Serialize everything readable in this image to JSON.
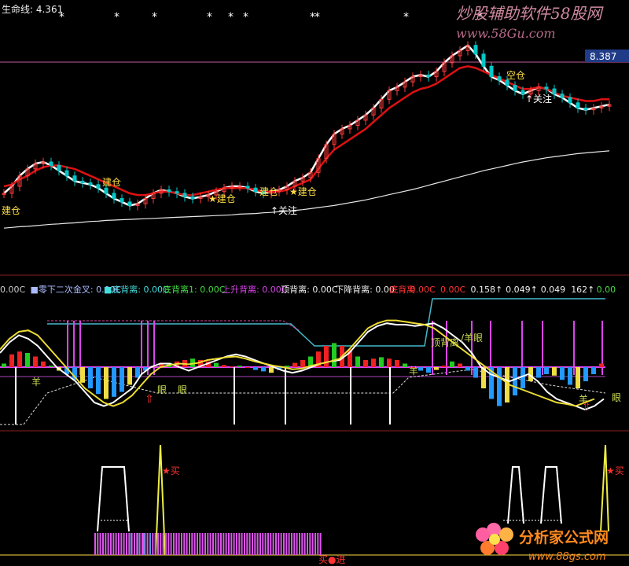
{
  "colors": {
    "background": "#000000",
    "ma_white": "#ffffff",
    "ma_red": "#dd1111",
    "candle_up": "#ff3b3b",
    "candle_down": "#00c8c8",
    "osc_red": "#ee2222",
    "osc_green": "#22cc22",
    "osc_blue": "#2299ff",
    "osc_yellow": "#eedd44",
    "magenta": "#dd44ee",
    "cyan": "#44bbcc",
    "divider": "#8a2020",
    "price_box": "#203c88"
  },
  "top_panel": {
    "indicator_label": "生命线: 4.361",
    "price_tag": "8.387",
    "signals": [
      {
        "text": "建仓",
        "style": "plain"
      },
      {
        "text": "建仓",
        "style": "plain"
      },
      {
        "text": "★建仓",
        "style": "star"
      },
      {
        "text": "建仓",
        "style": "plain"
      },
      {
        "text": "★建仓",
        "style": "star"
      },
      {
        "text": "↑关注",
        "style": "arrow"
      },
      {
        "text": "空仓",
        "style": "plain"
      },
      {
        "text": "↑关注",
        "style": "arrow"
      }
    ]
  },
  "middle_panel": {
    "legend": [
      {
        "text": "0.00C",
        "color": "#cccccc"
      },
      {
        "text": "■零下二次金叉: 0.00C",
        "color": "#aabbff"
      },
      {
        "text": "■底背离: 0.00C",
        "color": "#44dddd"
      },
      {
        "text": "底背离1: 0.00C",
        "color": "#44dd44"
      },
      {
        "text": "上升背离: 0.00C",
        "color": "#dd44ee"
      },
      {
        "text": "顶背离: 0.00C",
        "color": "#eeeeee"
      },
      {
        "text": "下降背离: 0.00",
        "color": "#eeeeee"
      },
      {
        "text": "底背离",
        "color": "#ff3333"
      },
      {
        "text": "0.00C",
        "color": "#ff3333"
      },
      {
        "text": "0.00C",
        "color": "#ff3333"
      },
      {
        "text": "0.158↑",
        "color": "#eeeeee"
      },
      {
        "text": "0.049↑",
        "color": "#eeeeee"
      },
      {
        "text": "0.049",
        "color": "#eeeeee"
      },
      {
        "text": "162↑",
        "color": "#eeeeee"
      },
      {
        "text": "0.00",
        "color": "#44dd44"
      }
    ],
    "annotations": [
      "羊",
      "眼",
      "眼",
      "顶背离",
      "/羊眼",
      "羊",
      "羊",
      "眼"
    ]
  },
  "bottom_panel": {
    "buy_labels": [
      "★买",
      "★买"
    ],
    "bottom_label": "买●进"
  },
  "watermarks": {
    "top": "炒股辅助软件58股网",
    "top_url": "www.58Gu.com",
    "bottom": "分析家公式网",
    "bottom_url": "www.88gs.com"
  },
  "chart_data": [
    {
      "type": "line",
      "panel": "price",
      "x": [
        0,
        10,
        20,
        30,
        40,
        50,
        60,
        70,
        80,
        90,
        100,
        110,
        120,
        130,
        140,
        150,
        160,
        170,
        180,
        190,
        200,
        210,
        220,
        230,
        240,
        250,
        260,
        270,
        280,
        290,
        300,
        310,
        320,
        330,
        340,
        350,
        360,
        370,
        380,
        390,
        400,
        410,
        420,
        430,
        440,
        450,
        460,
        470,
        480,
        490,
        500,
        510,
        520,
        530,
        540,
        550,
        560,
        570,
        580,
        590,
        600,
        610,
        620,
        630,
        640,
        650,
        660,
        670,
        680,
        690,
        700,
        710,
        720,
        730,
        740,
        750,
        760,
        770
      ],
      "series": [
        {
          "values": [
            5.1,
            5.3,
            5.6,
            5.8,
            5.95,
            6.0,
            5.9,
            5.75,
            5.6,
            5.45,
            5.4,
            5.35,
            5.25,
            5.1,
            4.95,
            4.85,
            4.75,
            4.8,
            4.95,
            5.1,
            5.2,
            5.15,
            5.1,
            5.0,
            4.95,
            5.0,
            5.05,
            5.15,
            5.25,
            5.3,
            5.3,
            5.25,
            5.15,
            5.1,
            5.15,
            5.2,
            5.3,
            5.45,
            5.55,
            5.7,
            6.1,
            6.5,
            6.8,
            6.95,
            7.05,
            7.2,
            7.35,
            7.55,
            7.8,
            8.05,
            8.15,
            8.3,
            8.45,
            8.5,
            8.45,
            8.6,
            8.85,
            9.05,
            9.2,
            9.35,
            9.1,
            8.75,
            8.45,
            8.35,
            8.2,
            8.05,
            7.95,
            8.05,
            8.15,
            8.1,
            7.95,
            7.85,
            7.7,
            7.55,
            7.5,
            7.55,
            7.6,
            7.65
          ]
        },
        {
          "values": [
            5.3,
            5.35,
            5.5,
            5.6,
            5.75,
            5.85,
            5.9,
            5.9,
            5.85,
            5.8,
            5.7,
            5.6,
            5.5,
            5.4,
            5.3,
            5.2,
            5.1,
            5.05,
            5.05,
            5.1,
            5.15,
            5.15,
            5.1,
            5.05,
            5.05,
            5.1,
            5.15,
            5.2,
            5.25,
            5.25,
            5.25,
            5.25,
            5.2,
            5.15,
            5.15,
            5.15,
            5.2,
            5.3,
            5.4,
            5.5,
            5.8,
            6.1,
            6.35,
            6.5,
            6.65,
            6.8,
            6.95,
            7.15,
            7.35,
            7.55,
            7.7,
            7.85,
            8.0,
            8.1,
            8.15,
            8.25,
            8.4,
            8.55,
            8.7,
            8.75,
            8.7,
            8.6,
            8.5,
            8.4,
            8.3,
            8.2,
            8.1,
            8.1,
            8.15,
            8.1,
            8.0,
            7.9,
            7.85,
            7.8,
            7.75,
            7.75,
            7.8,
            7.8
          ]
        },
        {
          "values": [
            4.1,
            4.12,
            4.14,
            4.15,
            4.17,
            4.19,
            4.21,
            4.22,
            4.24,
            4.25,
            4.27,
            4.29,
            4.3,
            4.32,
            4.33,
            4.34,
            4.35,
            4.36,
            4.37,
            4.38,
            4.39,
            4.4,
            4.41,
            4.42,
            4.43,
            4.44,
            4.45,
            4.46,
            4.47,
            4.48,
            4.5,
            4.51,
            4.52,
            4.54,
            4.55,
            4.57,
            4.59,
            4.61,
            4.63,
            4.66,
            4.69,
            4.72,
            4.75,
            4.79,
            4.83,
            4.87,
            4.91,
            4.96,
            5.01,
            5.06,
            5.11,
            5.16,
            5.21,
            5.27,
            5.33,
            5.39,
            5.45,
            5.51,
            5.57,
            5.63,
            5.69,
            5.75,
            5.8,
            5.85,
            5.9,
            5.95,
            6.0,
            6.04,
            6.08,
            6.12,
            6.15,
            6.18,
            6.21,
            6.24,
            6.26,
            6.28,
            6.3,
            6.32
          ]
        }
      ],
      "ylim": [
        3.2,
        9.75
      ]
    },
    {
      "type": "bar",
      "panel": "oscillator",
      "x": [
        0,
        10,
        20,
        30,
        40,
        50,
        60,
        70,
        80,
        90,
        100,
        110,
        120,
        130,
        140,
        150,
        160,
        170,
        180,
        190,
        200,
        210,
        220,
        230,
        240,
        250,
        260,
        270,
        280,
        290,
        300,
        310,
        320,
        330,
        340,
        350,
        360,
        370,
        380,
        390,
        400,
        410,
        420,
        430,
        440,
        450,
        460,
        470,
        480,
        490,
        500,
        510,
        520,
        530,
        540,
        550,
        560,
        570,
        580,
        590,
        600,
        610,
        620,
        630,
        640,
        650,
        660,
        670,
        680,
        690,
        700,
        710,
        720,
        730,
        740,
        750,
        760
      ],
      "values": [
        0.05,
        0.18,
        0.22,
        0.2,
        0.15,
        0.08,
        0.02,
        -0.05,
        -0.1,
        -0.18,
        -0.22,
        -0.3,
        -0.38,
        -0.45,
        -0.42,
        -0.35,
        -0.25,
        -0.15,
        -0.05,
        0.02,
        0.05,
        0.06,
        0.08,
        0.1,
        0.12,
        0.1,
        0.08,
        0.06,
        0.03,
        0.01,
        0.02,
        0.0,
        -0.04,
        -0.06,
        -0.08,
        -0.04,
        0.02,
        0.06,
        0.1,
        0.15,
        0.22,
        0.3,
        0.34,
        0.3,
        0.25,
        0.15,
        0.1,
        0.12,
        0.14,
        0.12,
        0.1,
        0.05,
        0.0,
        -0.05,
        -0.08,
        -0.04,
        0.02,
        0.08,
        0.05,
        -0.05,
        -0.15,
        -0.3,
        -0.45,
        -0.55,
        -0.5,
        -0.4,
        -0.3,
        -0.2,
        -0.15,
        -0.1,
        -0.12,
        -0.18,
        -0.25,
        -0.3,
        -0.2,
        -0.1,
        0.05
      ],
      "lines": [
        {
          "values": [
            0.2,
            0.35,
            0.45,
            0.4,
            0.3,
            0.15,
            0.0,
            -0.1,
            -0.2,
            -0.35,
            -0.5,
            -0.55,
            -0.5,
            -0.4,
            -0.3,
            -0.1,
            0.0,
            0.05,
            0.05,
            0.0,
            -0.05,
            0.0,
            0.05,
            0.1,
            0.15,
            0.18,
            0.15,
            0.1,
            0.05,
            0.0,
            -0.05,
            -0.08,
            -0.05,
            0.0,
            0.05,
            0.08,
            0.1,
            0.2,
            0.35,
            0.5,
            0.58,
            0.62,
            0.6,
            0.6,
            0.58,
            0.6,
            0.62,
            0.55,
            0.45,
            0.35,
            0.2,
            0.0,
            -0.1,
            -0.15,
            -0.2,
            -0.15,
            -0.1,
            -0.2,
            -0.35,
            -0.45,
            -0.5,
            -0.55,
            -0.6,
            -0.55,
            -0.45
          ]
        },
        {
          "values": [
            0.25,
            0.4,
            0.5,
            0.52,
            0.45,
            0.3,
            0.15,
            0.0,
            -0.15,
            -0.3,
            -0.4,
            -0.5,
            -0.55,
            -0.5,
            -0.4,
            -0.25,
            -0.1,
            0.0,
            0.03,
            0.05,
            0.04,
            0.06,
            0.1,
            0.12,
            0.14,
            0.15,
            0.12,
            0.08,
            0.05,
            0.02,
            0.0,
            -0.03,
            -0.02,
            0.02,
            0.05,
            0.08,
            0.12,
            0.25,
            0.4,
            0.55,
            0.62,
            0.66,
            0.66,
            0.64,
            0.62,
            0.6,
            0.55,
            0.45,
            0.35,
            0.25,
            0.15,
            0.05,
            -0.05,
            -0.15,
            -0.25,
            -0.3,
            -0.35,
            -0.4,
            -0.45,
            -0.5,
            -0.52,
            -0.55,
            -0.5,
            -0.45
          ]
        }
      ],
      "ylim": [
        -1.0,
        1.0
      ]
    },
    {
      "type": "bar",
      "panel": "signal",
      "x": [
        120,
        130,
        140,
        150,
        160,
        170,
        180,
        190,
        200,
        210,
        220,
        230,
        240,
        250,
        260,
        270,
        280,
        290,
        300,
        310,
        320,
        330,
        340,
        350,
        360,
        370,
        380,
        390,
        400
      ],
      "values": [
        0.25,
        0.25,
        0.25,
        0.25,
        0.25,
        0.25,
        0.25,
        0.25,
        0.25,
        0.25,
        0.25,
        0.25,
        0.25,
        0.25,
        0.25,
        0.25,
        0.25,
        0.25,
        0.25,
        0.25,
        0.25,
        0.25,
        0.25,
        0.25,
        0.25,
        0.25,
        0.25,
        0.25,
        0.25
      ],
      "ylim": [
        0,
        1
      ]
    }
  ]
}
